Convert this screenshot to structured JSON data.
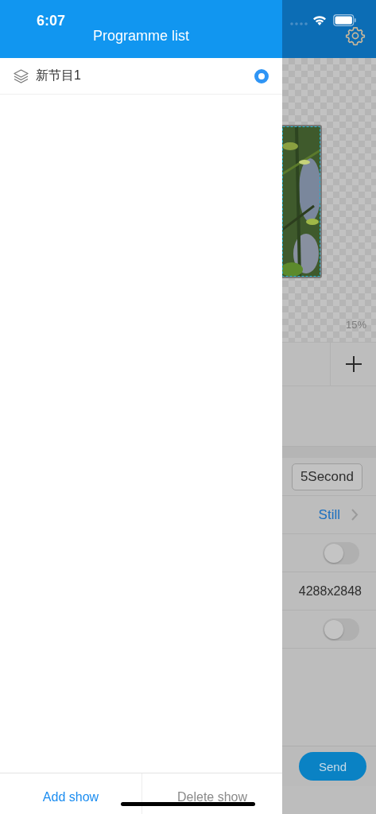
{
  "status_bar": {
    "time": "6:07"
  },
  "drawer": {
    "title": "Programme list",
    "programmes": [
      {
        "name": "新节目1",
        "selected": true
      }
    ],
    "actions": [
      {
        "label": "Add show",
        "disabled": false
      },
      {
        "label": "Delete show",
        "disabled": true
      }
    ]
  },
  "background": {
    "zoom": "15%",
    "rows": [
      {
        "kind": "stepper",
        "value": "5Second"
      },
      {
        "kind": "link",
        "value": "Still"
      },
      {
        "kind": "switch",
        "on": false
      },
      {
        "kind": "text",
        "value": "4288x2848"
      },
      {
        "kind": "switch",
        "on": false
      }
    ],
    "send": "Send"
  }
}
